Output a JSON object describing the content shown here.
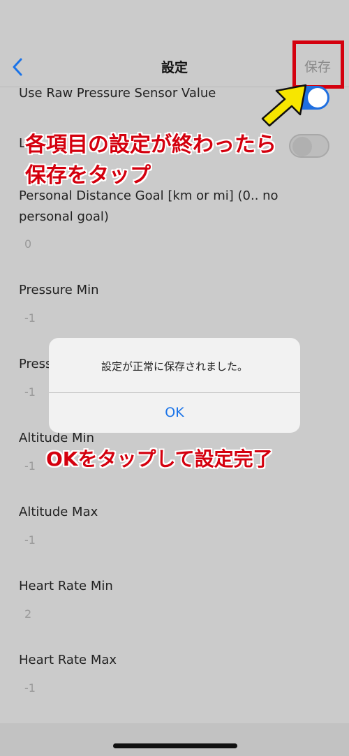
{
  "nav": {
    "title": "設定",
    "save_label": "保存"
  },
  "settings": {
    "raw_pressure_label": "Use Raw Pressure Sensor Value",
    "raw_pressure_on": true,
    "second_toggle_label_visible": "L",
    "second_toggle_on": false,
    "distance_goal_line1": "Personal Distance Goal [km or mi] (0.. no",
    "distance_goal_line2": "personal goal)",
    "distance_goal_value": "0",
    "pressure_min_label": "Pressure Min",
    "pressure_min_value": "-1",
    "pressure_max_label_visible": "Press",
    "pressure_max_value": "-1",
    "altitude_min_label": "Altitude Min",
    "altitude_min_value": "-1",
    "altitude_max_label": "Altitude Max",
    "altitude_max_value": "-1",
    "heart_rate_min_label": "Heart Rate Min",
    "heart_rate_min_value": "2",
    "heart_rate_max_label": "Heart Rate Max",
    "heart_rate_max_value": "-1"
  },
  "dialog": {
    "message": "設定が正常に保存されました。",
    "ok_label": "OK"
  },
  "annotations": {
    "save_line1": "各項目の設定が終わったら",
    "save_line2": "保存をタップ",
    "ok": "OKをタップして設定完了"
  },
  "colors": {
    "accent_blue": "#1a73e8",
    "annotation_red": "#d4000e",
    "arrow_yellow": "#f7e600"
  },
  "icons": {
    "back": "chevron-left-icon",
    "arrow": "arrow-up-right-icon"
  }
}
